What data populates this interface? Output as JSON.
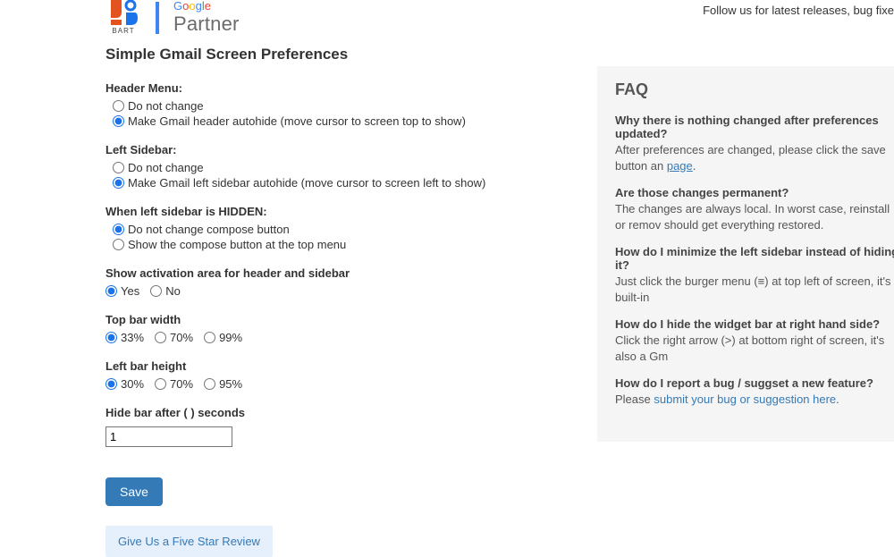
{
  "topbar": {
    "follow_text": "Follow us for latest releases, bug fixe"
  },
  "logo": {
    "bart_text": "BART",
    "google": "Google",
    "partner": "Partner"
  },
  "title": "Simple Gmail Screen Preferences",
  "headerMenu": {
    "heading": "Header Menu:",
    "opt1": "Do not change",
    "opt2": "Make Gmail header autohide (move cursor to screen top to show)"
  },
  "leftSidebar": {
    "heading": "Left Sidebar:",
    "opt1": "Do not change",
    "opt2": "Make Gmail left sidebar autohide (move cursor to screen left to show)"
  },
  "hiddenSidebar": {
    "heading": "When left sidebar is HIDDEN:",
    "opt1": "Do not change compose button",
    "opt2": "Show the compose button at the top menu"
  },
  "activation": {
    "heading": "Show activation area for header and sidebar",
    "yes": "Yes",
    "no": "No"
  },
  "topbarWidth": {
    "heading": "Top bar width",
    "o1": "33%",
    "o2": "70%",
    "o3": "99%"
  },
  "leftbarHeight": {
    "heading": "Left bar height",
    "o1": "30%",
    "o2": "70%",
    "o3": "95%"
  },
  "hideAfter": {
    "heading": "Hide bar after ( ) seconds",
    "value": "1"
  },
  "buttons": {
    "save": "Save",
    "review": "Give Us a Five Star Review"
  },
  "faq": {
    "title": "FAQ",
    "items": [
      {
        "q": "Why there is nothing changed after preferences updated?",
        "a_pre": "After preferences are changed, please click the save button an",
        "link": "page",
        "a_post": "."
      },
      {
        "q": "Are those changes permanent?",
        "a": "The changes are always local. In worst case, reinstall or remov should get everything restored."
      },
      {
        "q": "How do I minimize the left sidebar instead of hiding it?",
        "a": "Just click the burger menu (≡) at top left of screen, it's a built-in"
      },
      {
        "q": "How do I hide the widget bar at right hand side?",
        "a": "Click the right arrow (>) at bottom right of screen, it's also a Gm"
      },
      {
        "q": "How do I report a bug / suggset a new feature?",
        "a_pre": "Please ",
        "link": "submit your bug or suggestion here",
        "a_post": "."
      }
    ]
  }
}
